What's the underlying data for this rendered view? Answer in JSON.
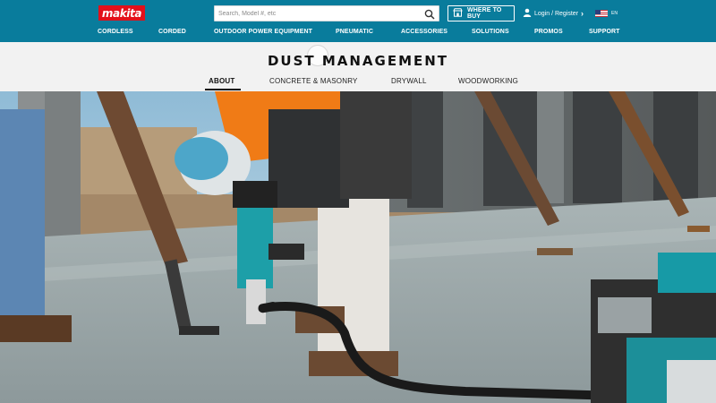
{
  "brand": {
    "logo_text": "makita",
    "logo_color": "#e3101a",
    "header_color": "#097c9c"
  },
  "search": {
    "placeholder": "Search, Model #, etc",
    "icon": "search-icon"
  },
  "where_to_buy": {
    "label": "WHERE TO BUY",
    "icon": "store-icon"
  },
  "account": {
    "label": "Login / Register",
    "icon": "user-icon",
    "chevron": "›"
  },
  "language": {
    "code": "EN",
    "icon": "us-flag-icon"
  },
  "nav": {
    "items": [
      {
        "label": "CORDLESS"
      },
      {
        "label": "CORDED"
      },
      {
        "label": "OUTDOOR POWER EQUIPMENT"
      },
      {
        "label": "PNEUMATIC"
      },
      {
        "label": "ACCESSORIES"
      },
      {
        "label": "SOLUTIONS"
      },
      {
        "label": "PROMOS"
      },
      {
        "label": "SUPPORT"
      }
    ]
  },
  "page": {
    "title": "DUST MANAGEMENT",
    "tabs": [
      {
        "label": "ABOUT",
        "active": true
      },
      {
        "label": "CONCRETE & MASONRY",
        "active": false
      },
      {
        "label": "DRYWALL",
        "active": false
      },
      {
        "label": "WOODWORKING",
        "active": false
      }
    ]
  },
  "hero": {
    "description_icon": "hero-photo-worker-demolition-hammer-with-dust-extractor"
  }
}
